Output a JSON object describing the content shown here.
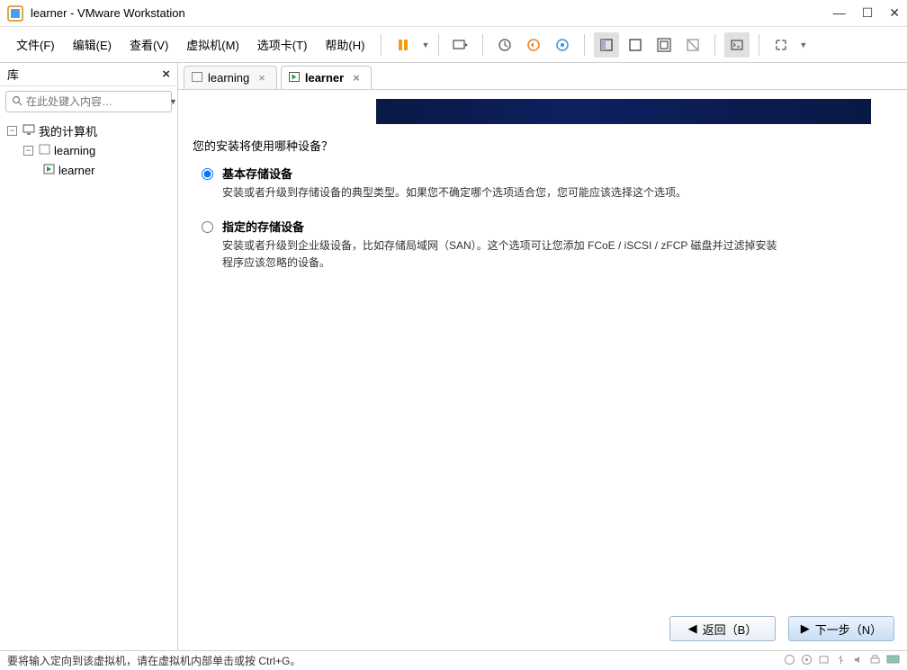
{
  "window": {
    "title": "learner - VMware Workstation"
  },
  "menu": {
    "file": "文件(F)",
    "edit": "编辑(E)",
    "view": "查看(V)",
    "vm": "虚拟机(M)",
    "tabs": "选项卡(T)",
    "help": "帮助(H)"
  },
  "sidebar": {
    "title": "库",
    "search_placeholder": "在此处键入内容…",
    "tree": {
      "root": "我的计算机",
      "child1": "learning",
      "child2": "learner"
    }
  },
  "tabs": [
    {
      "label": "learning",
      "active": false
    },
    {
      "label": "learner",
      "active": true
    }
  ],
  "installer": {
    "question": "您的安装将使用哪种设备？",
    "opt1_label": "基本存储设备",
    "opt1_desc": "安装或者升级到存储设备的典型类型。如果您不确定哪个选项适合您，您可能应该选择这个选项。",
    "opt2_label": "指定的存储设备",
    "opt2_desc": "安装或者升级到企业级设备，比如存储局域网（SAN）。这个选项可让您添加 FCoE / iSCSI / zFCP 磁盘并过滤掉安装程序应该忽略的设备。"
  },
  "buttons": {
    "back": "返回（B）",
    "next": "下一步（N）"
  },
  "statusbar": {
    "hint": "要将输入定向到该虚拟机，请在虚拟机内部单击或按 Ctrl+G。"
  }
}
